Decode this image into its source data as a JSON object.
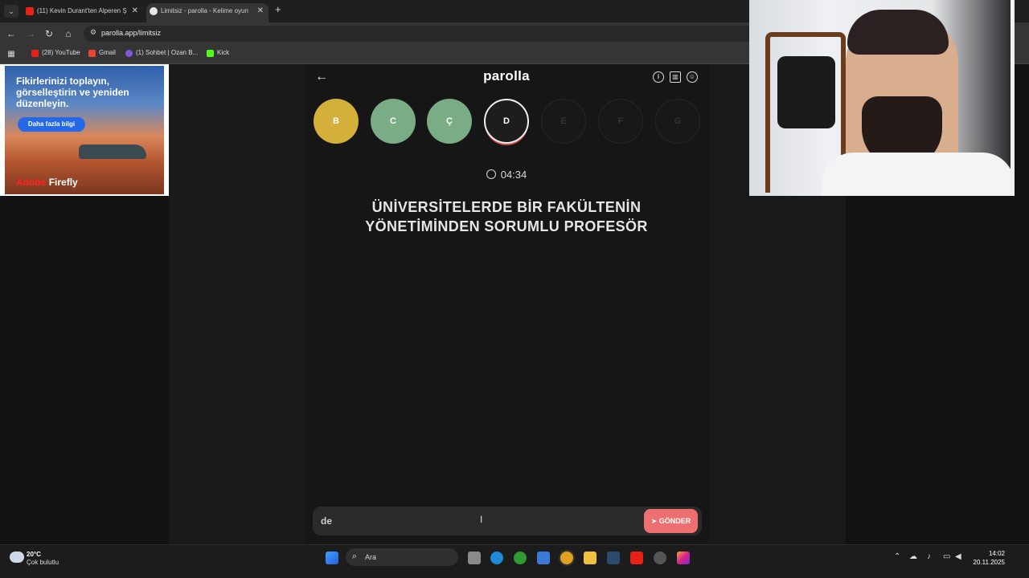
{
  "browser": {
    "tabs": [
      {
        "label": "(11) Kevin Durant'ten Alperen Ş"
      },
      {
        "label": "Limitsiz - parolla - Kelime oyun"
      }
    ],
    "new_tab": "+",
    "url": "parolla.app/limitsiz",
    "bookmarks": [
      {
        "label": "(28) YouTube"
      },
      {
        "label": "Gmail"
      },
      {
        "label": "(1) Sohbet | Ozan B..."
      },
      {
        "label": "Kick"
      }
    ]
  },
  "ad": {
    "headline": "Fikirlerinizi toplayın, görselleştirin ve yeniden düzenleyin.",
    "button": "Daha fazla bilgi",
    "brand_adobe": "Adobe",
    "brand_product": "Firefly"
  },
  "game": {
    "logo": "parolla",
    "letters": [
      {
        "label": "B",
        "state": "correct"
      },
      {
        "label": "C",
        "state": "passed"
      },
      {
        "label": "Ç",
        "state": "passed"
      },
      {
        "label": "D",
        "state": "current"
      },
      {
        "label": "E",
        "state": "pending"
      },
      {
        "label": "F",
        "state": "pending"
      },
      {
        "label": "G",
        "state": "pending"
      }
    ],
    "timer": "04:34",
    "question": "ÜNİVERSİTELERDE BİR FAKÜLTENİN YÖNETİMİNDEN SORUMLU PROFESÖR",
    "answer_value": "de",
    "send_label": "GÖNDER",
    "colors": {
      "correct": "#d4b03a",
      "passed": "#7aac85",
      "send": "#ee6f6f"
    }
  },
  "taskbar": {
    "temp": "20°C",
    "weather": "Çok bulutlu",
    "search": "Ara",
    "time": "14:02",
    "date": "20.11.2025"
  }
}
